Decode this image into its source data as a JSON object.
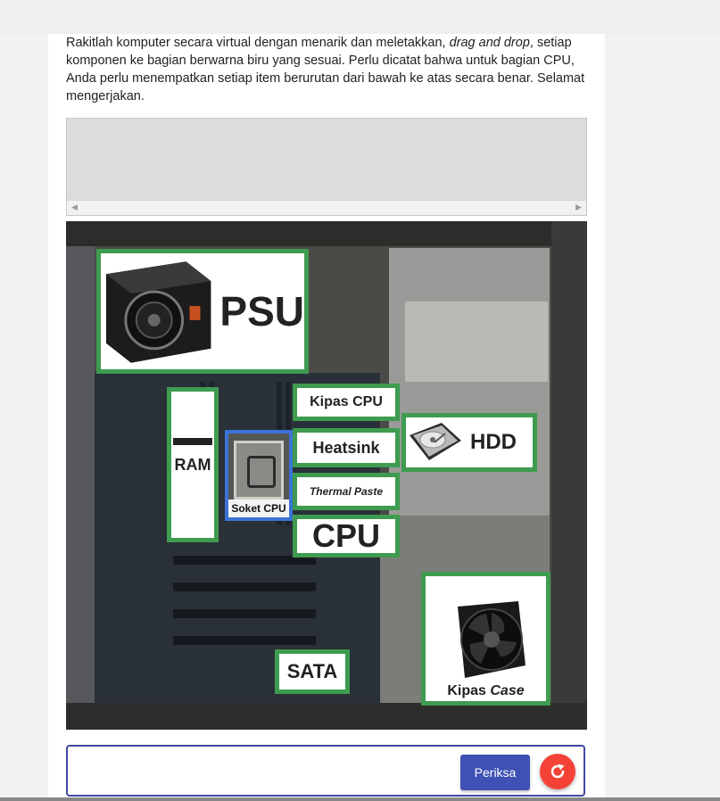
{
  "instructions": {
    "part1": "Rakitlah komputer secara virtual dengan menarik dan meletakkan, ",
    "italic": "drag and drop",
    "part2": ", setiap komponen ke bagian berwarna biru yang sesuai. Perlu dicatat bahwa untuk bagian CPU, Anda perlu menempatkan setiap item berurutan dari bawah ke atas secara benar. Selamat mengerjakan."
  },
  "parts": {
    "psu": "PSU",
    "ram": "RAM",
    "cpu_fan": "Kipas CPU",
    "heatsink": "Heatsink",
    "thermal_paste": "Thermal Paste",
    "cpu": "CPU",
    "hdd": "HDD",
    "sata": "SATA",
    "case_fan_prefix": "Kipas ",
    "case_fan_italic": "Case"
  },
  "socket_label": "Soket CPU",
  "buttons": {
    "check": "Periksa"
  },
  "colors": {
    "part_border": "#3e9b4f",
    "socket_border": "#3c72d6",
    "check_button": "#3f51b5",
    "reset_button": "#f44336"
  }
}
